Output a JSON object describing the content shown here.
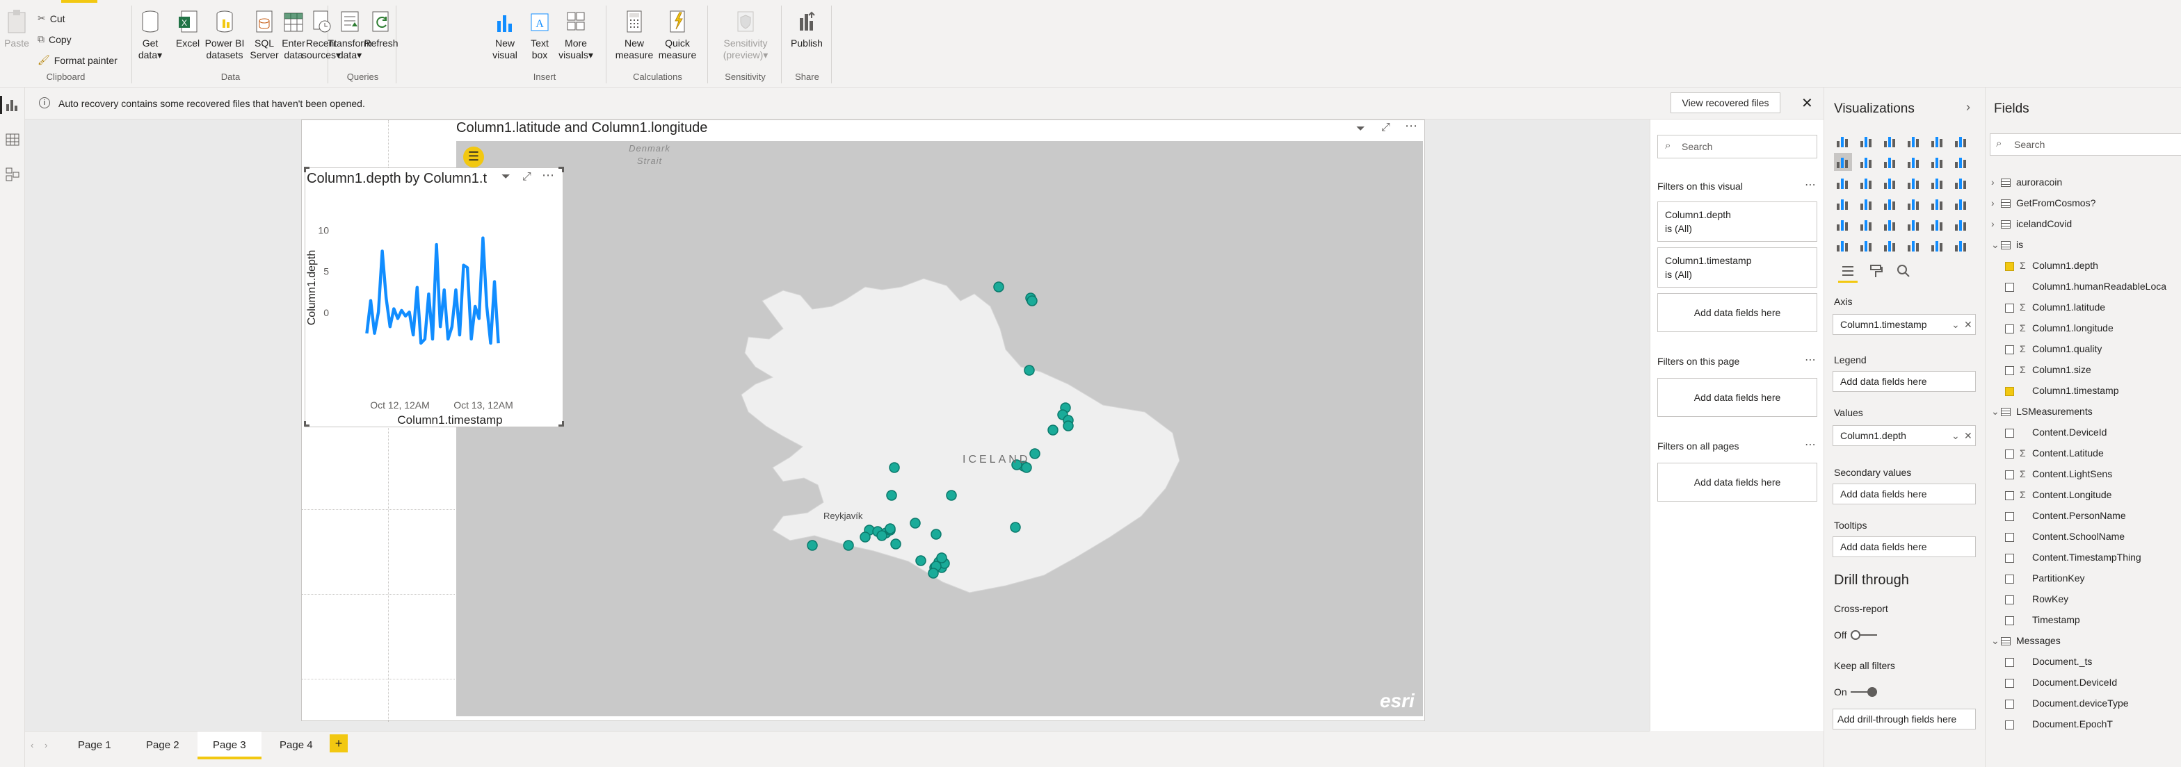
{
  "ribbon": {
    "clipboard": {
      "paste": "Paste",
      "cut": "Cut",
      "copy": "Copy",
      "format_painter": "Format painter",
      "label": "Clipboard"
    },
    "data": {
      "get_data": [
        "Get",
        "data"
      ],
      "excel": "Excel",
      "powerbi": [
        "Power BI",
        "datasets"
      ],
      "sql": [
        "SQL",
        "Server"
      ],
      "enter": [
        "Enter",
        "data"
      ],
      "recent": [
        "Recent",
        "sources"
      ],
      "label": "Data"
    },
    "queries": {
      "transform": [
        "Transform",
        "data"
      ],
      "refresh": "Refresh",
      "label": "Queries"
    },
    "insert": {
      "new_visual": [
        "New",
        "visual"
      ],
      "text_box": [
        "Text",
        "box"
      ],
      "more_visuals": [
        "More",
        "visuals"
      ],
      "label": "Insert"
    },
    "calculations": {
      "new_measure": [
        "New",
        "measure"
      ],
      "quick_measure": [
        "Quick",
        "measure"
      ],
      "label": "Calculations"
    },
    "sensitivity": {
      "btn": [
        "Sensitivity",
        "(preview)"
      ],
      "label": "Sensitivity"
    },
    "share": {
      "publish": "Publish",
      "label": "Share"
    }
  },
  "banner": {
    "text": "Auto recovery contains some recovered files that haven't been opened.",
    "button": "View recovered files"
  },
  "map_visual": {
    "title": "Column1.latitude and Column1.longitude",
    "labels": {
      "strait": [
        "Denmark",
        "Strait"
      ],
      "country": "ICELAND",
      "city": "Reykjavík",
      "brand": "esri"
    }
  },
  "line_visual": {
    "title": "Column1.depth by Column1.t"
  },
  "chart_data": {
    "type": "line",
    "title": "Column1.depth by Column1.t",
    "xlabel": "Column1.timestamp",
    "ylabel": "Column1.depth",
    "yticks": [
      "10",
      "5",
      "0"
    ],
    "xticks": [
      "Oct 12, 12AM",
      "Oct 13, 12AM"
    ],
    "ylim": [
      0,
      14
    ],
    "series": [
      {
        "values": [
          2.2,
          6.2,
          2.2,
          4.8,
          12.2,
          6.5,
          3.0,
          5.2,
          4.0,
          5.0,
          4.3,
          4.8,
          2.0,
          7.8,
          1.0,
          1.5,
          7.0,
          1.5,
          13.0,
          3.0,
          7.5,
          1.5,
          3.0,
          7.5,
          2.0,
          10.5,
          10.2,
          1.5,
          5.5,
          4.0,
          13.8,
          5.5,
          1.0,
          8.5,
          1.0
        ]
      }
    ],
    "color": "#118dff"
  },
  "filters": {
    "search_placeholder": "Search",
    "on_visual": "Filters on this visual",
    "depth_name": "Column1.depth",
    "depth_state": "is (All)",
    "timestamp_name": "Column1.timestamp",
    "timestamp_state": "is (All)",
    "add": "Add data fields here",
    "on_page": "Filters on this page",
    "on_all": "Filters on all pages"
  },
  "viz": {
    "title": "Visualizations",
    "axis": "Axis",
    "axis_value": "Column1.timestamp",
    "legend": "Legend",
    "values": "Values",
    "values_value": "Column1.depth",
    "secondary": "Secondary values",
    "tooltips": "Tooltips",
    "add": "Add data fields here",
    "drill": "Drill through",
    "cross_report": "Cross-report",
    "off": "Off",
    "keep_filters": "Keep all filters",
    "on": "On",
    "add_drill": "Add drill-through fields here"
  },
  "fields": {
    "title": "Fields",
    "search_placeholder": "Search",
    "tables": [
      "auroracoin",
      "GetFromCosmos?",
      "icelandCovid",
      "is",
      "LSMeasurements",
      "Messages"
    ],
    "is_fields": [
      "Column1.depth",
      "Column1.humanReadableLoca",
      "Column1.latitude",
      "Column1.longitude",
      "Column1.quality",
      "Column1.size",
      "Column1.timestamp"
    ],
    "ls_fields": [
      "Content.DeviceId",
      "Content.Latitude",
      "Content.LightSens",
      "Content.Longitude",
      "Content.PersonName",
      "Content.SchoolName",
      "Content.TimestampThing",
      "PartitionKey",
      "RowKey",
      "Timestamp"
    ],
    "msg_fields": [
      "Document._ts",
      "Document.DeviceId",
      "Document.deviceType",
      "Document.EpochT"
    ]
  },
  "pages": [
    "Page 1",
    "Page 2",
    "Page 3",
    "Page 4"
  ],
  "add_page": "+"
}
